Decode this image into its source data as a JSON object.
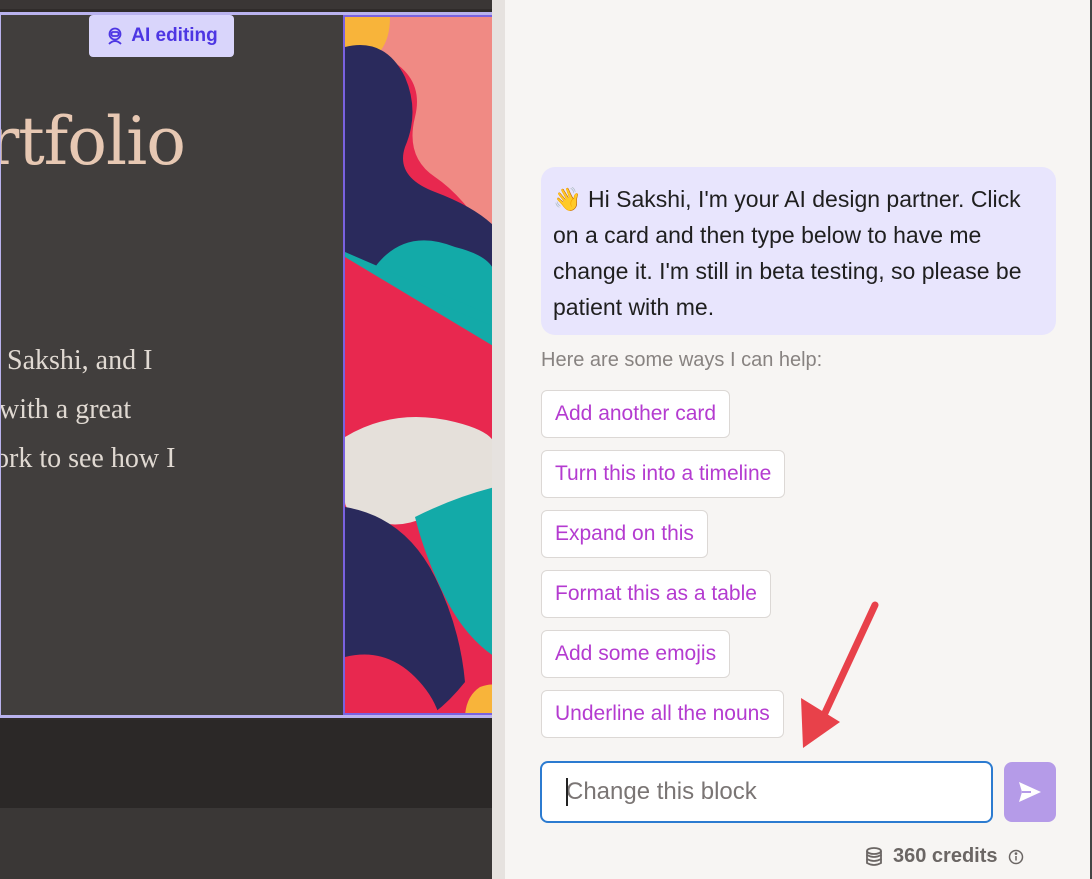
{
  "editor": {
    "ai_badge": {
      "label": "AI editing",
      "icon": "robot-icon"
    },
    "card": {
      "title": "ortfolio",
      "body_lines": [
        "Sakshi, and I",
        "with a great",
        "ork to see how I"
      ]
    }
  },
  "ai_panel": {
    "greeting": {
      "emoji": "👋",
      "text": "Hi Sakshi, I'm your AI design partner. Click on a card and then type below to have me change it. I'm still in beta testing, so please be patient with me."
    },
    "help_label": "Here are some ways I can help:",
    "suggestions": [
      {
        "label": "Add another card"
      },
      {
        "label": "Turn this into a timeline"
      },
      {
        "label": "Expand on this"
      },
      {
        "label": "Format this as a table"
      },
      {
        "label": "Add some emojis"
      },
      {
        "label": "Underline all the nouns"
      }
    ],
    "input": {
      "placeholder": "Change this block",
      "value": ""
    },
    "send_button": {
      "icon": "send-icon"
    },
    "credits": {
      "label": "360 credits",
      "icon": "coins-icon",
      "info_icon": "info-icon"
    }
  },
  "colors": {
    "accent": "#b43bd0",
    "badge_text": "#4d36e3",
    "input_border": "#2c7bd0",
    "send_button": "#b59be8",
    "arrow": "#e8414a"
  }
}
